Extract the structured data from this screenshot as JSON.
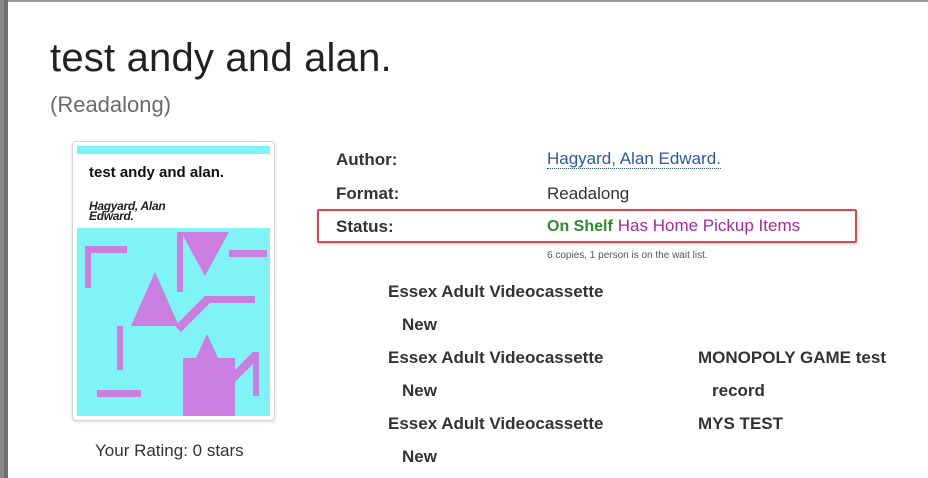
{
  "record": {
    "title": "test andy and alan.",
    "format_subtitle": "(Readalong)"
  },
  "cover": {
    "title": "test andy and alan.",
    "author": "Hagyard, Alan Edward.",
    "colors": {
      "background": "#7ff3f6",
      "shapes": "#c97ee0",
      "top_bar": "#7ff3f6"
    }
  },
  "rating": {
    "label": "Your Rating: 0 stars"
  },
  "details": {
    "author_label": "Author:",
    "author_value": "Hagyard, Alan Edward.",
    "format_label": "Format:",
    "format_value": "Readalong",
    "status_label": "Status:",
    "status_on_shelf": "On Shelf",
    "status_pickup": "Has Home Pickup Items",
    "copies_note": "6 copies, 1 person is on the wait list."
  },
  "holdings": [
    {
      "location": "Essex Adult Videocassette",
      "status": "New",
      "note": []
    },
    {
      "location": "Essex Adult Videocassette",
      "status": "New",
      "note": [
        "MONOPOLY GAME test",
        "record"
      ]
    },
    {
      "location": "Essex Adult Videocassette",
      "status": "New",
      "note": [
        "MYS TEST"
      ]
    }
  ],
  "colors": {
    "link": "#2a5a9a",
    "on_shelf": "#2f8a2f",
    "pickup": "#a52a9e",
    "highlight_box": "#e0474c"
  }
}
